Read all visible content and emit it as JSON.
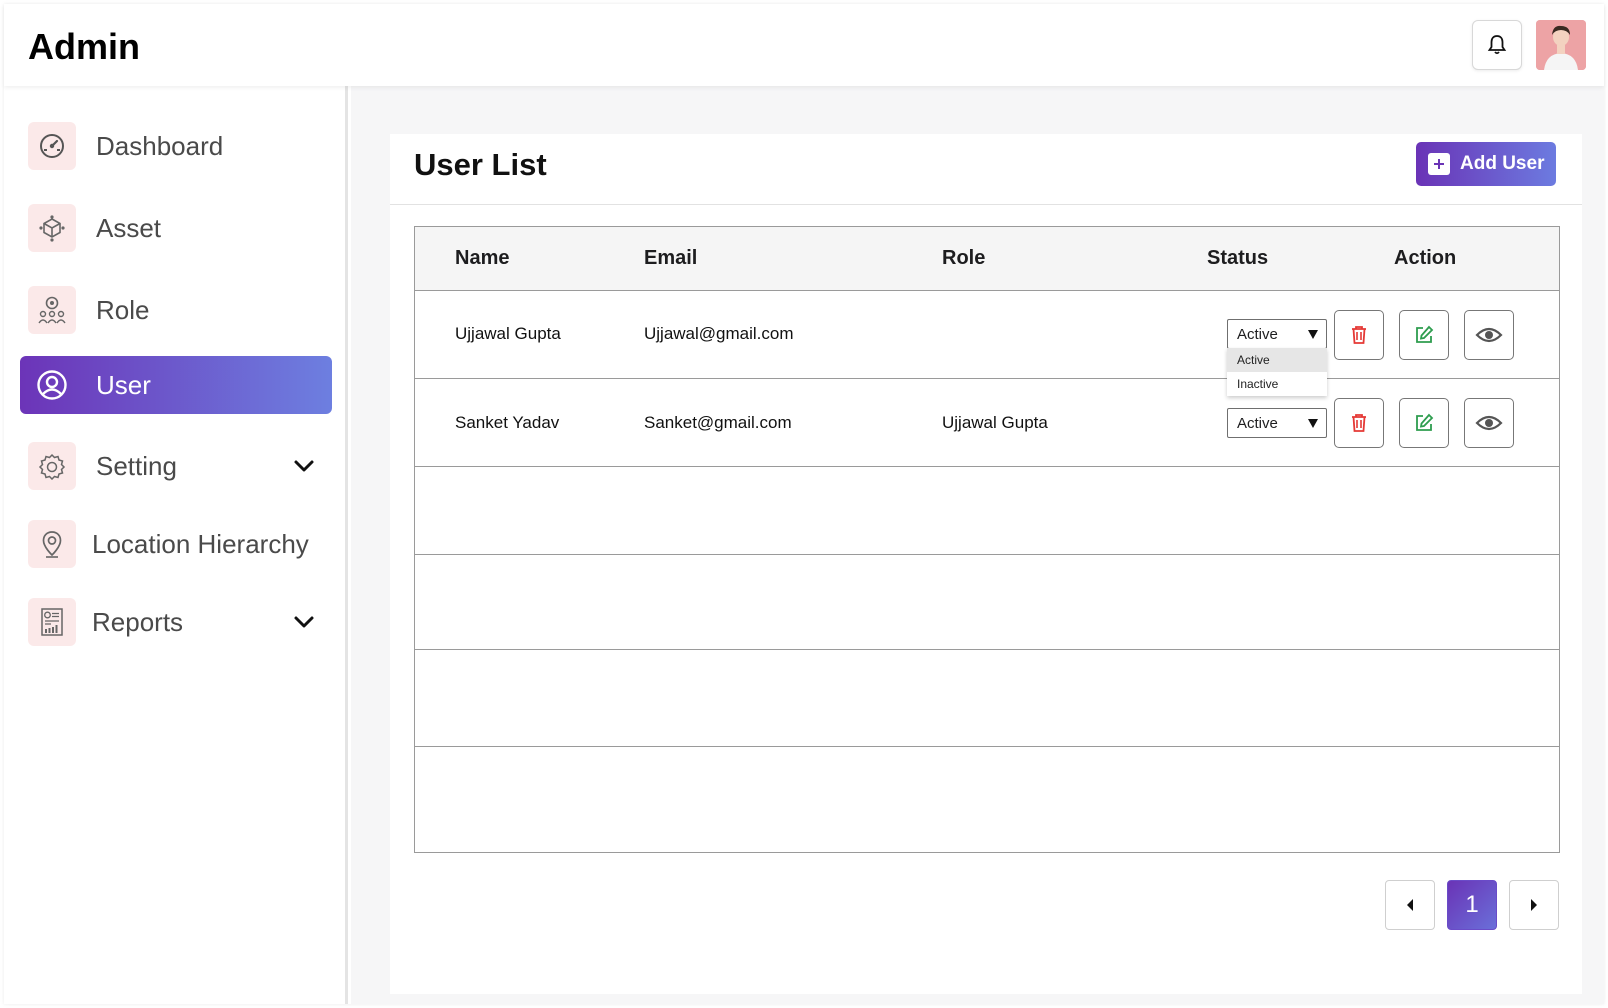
{
  "header": {
    "title": "Admin"
  },
  "sidebar": {
    "items": [
      {
        "label": "Dashboard",
        "icon": "dashboard-gauge-icon"
      },
      {
        "label": "Asset",
        "icon": "asset-cube-icon"
      },
      {
        "label": "Role",
        "icon": "role-group-icon"
      },
      {
        "label": "User",
        "icon": "user-circle-icon",
        "active": true
      },
      {
        "label": "Setting",
        "icon": "gear-icon",
        "has_dropdown": true
      },
      {
        "label": "Location Hierarchy",
        "icon": "location-pin-icon"
      },
      {
        "label": "Reports",
        "icon": "report-icon",
        "has_dropdown": true
      }
    ]
  },
  "main": {
    "title": "User List",
    "add_button": "Add User",
    "table": {
      "columns": [
        "Name",
        "Email",
        "Role",
        "Status",
        "Action"
      ],
      "rows": [
        {
          "name": "Ujjawal Gupta",
          "email": "Ujjawal@gmail.com",
          "role": "",
          "status": "Active"
        },
        {
          "name": "Sanket Yadav",
          "email": "Sanket@gmail.com",
          "role": "Ujjawal Gupta",
          "status": "Active"
        }
      ],
      "status_options": [
        "Active",
        "Inactive"
      ]
    },
    "pagination": {
      "current": "1"
    }
  },
  "colors": {
    "accent_start": "#6a33b6",
    "accent_end": "#6c7be0",
    "delete": "#e53935",
    "edit": "#2e9d4f",
    "icon_bg": "#fbe9e9"
  }
}
